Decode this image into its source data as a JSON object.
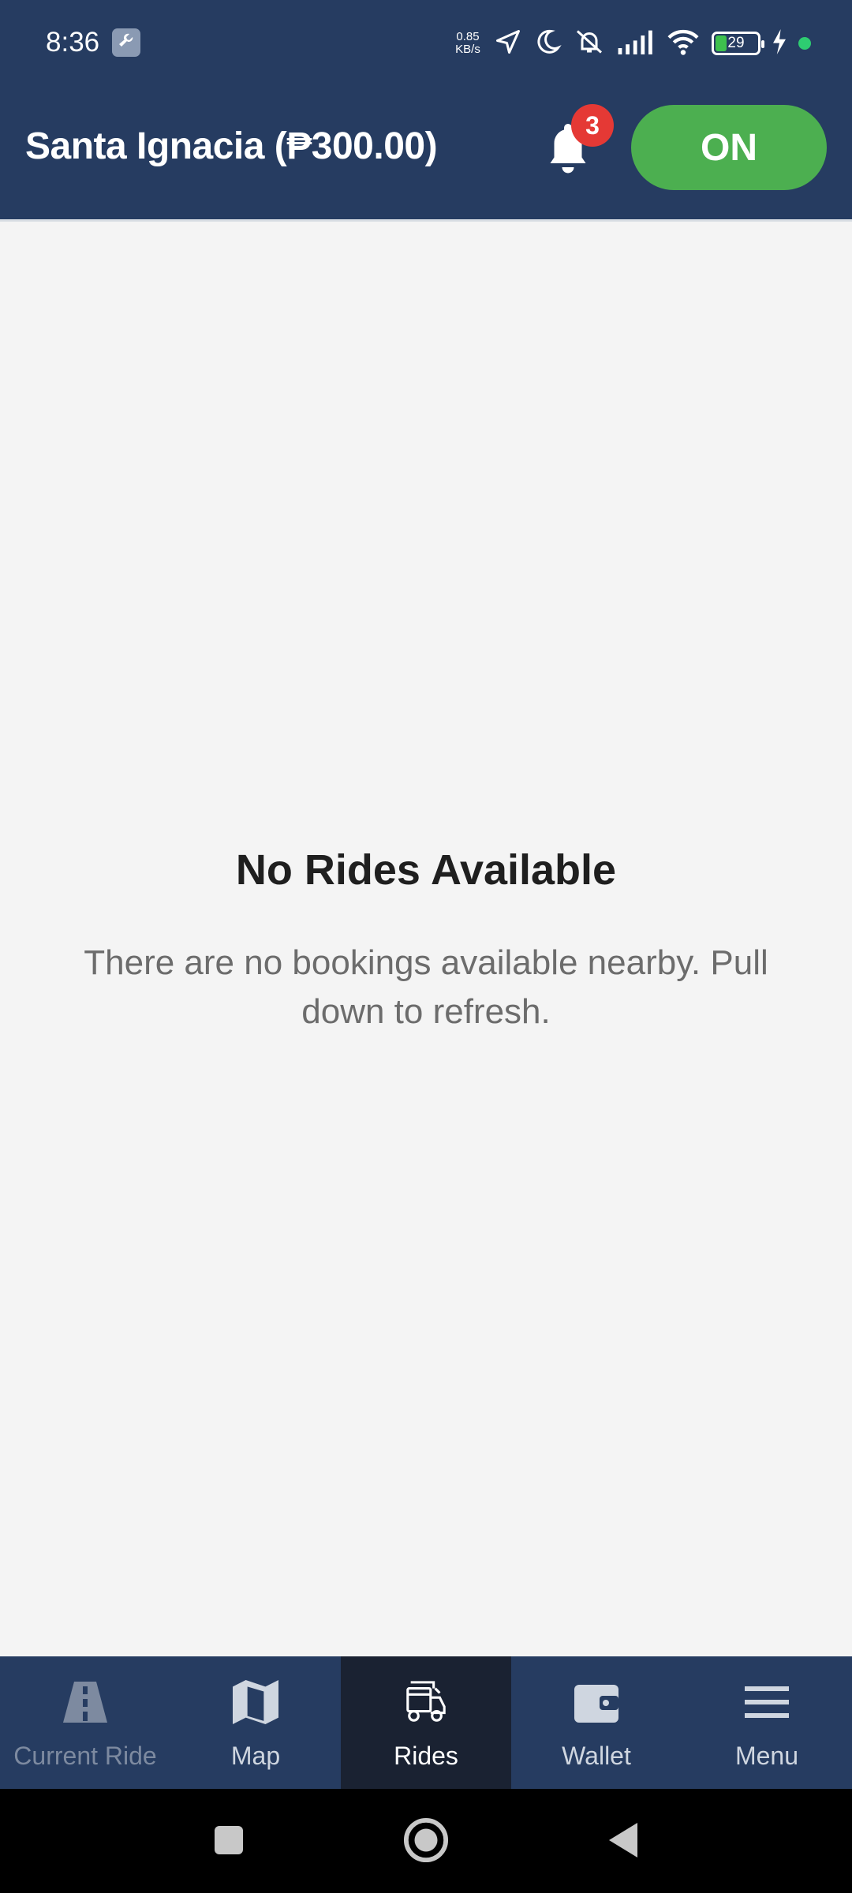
{
  "status_bar": {
    "time": "8:36",
    "net_speed_value": "0.85",
    "net_speed_unit": "KB/s",
    "battery_level": "29"
  },
  "header": {
    "title": "Santa Ignacia (₱300.00)",
    "notification_count": "3",
    "toggle_label": "ON",
    "colors": {
      "background": "#263c61",
      "toggle": "#4caf50",
      "badge": "#e53935"
    }
  },
  "empty_state": {
    "title": "No Rides Available",
    "description": "There are no bookings available nearby. Pull down to refresh."
  },
  "bottom_nav": {
    "items": [
      {
        "label": "Current Ride",
        "icon": "road-icon"
      },
      {
        "label": "Map",
        "icon": "map-icon"
      },
      {
        "label": "Rides",
        "icon": "tricycle-icon"
      },
      {
        "label": "Wallet",
        "icon": "wallet-icon"
      },
      {
        "label": "Menu",
        "icon": "menu-icon"
      }
    ],
    "active": "Rides"
  }
}
